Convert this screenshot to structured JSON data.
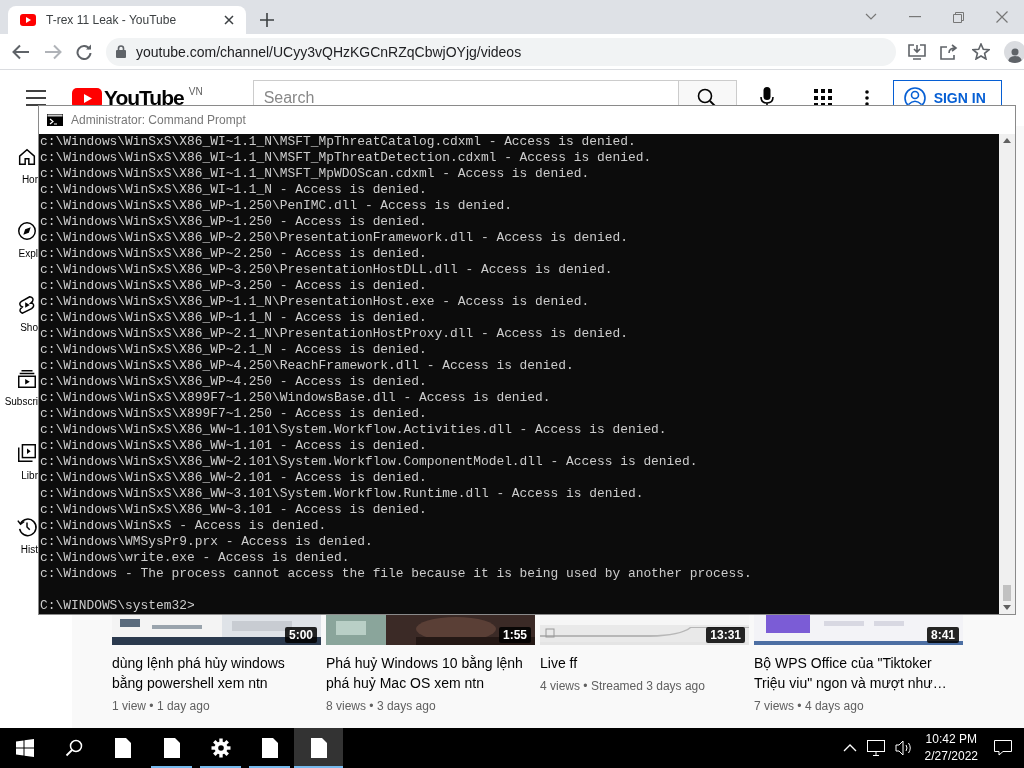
{
  "browser": {
    "tab": {
      "title": "T-rex 11 Leak - YouTube",
      "selected": true
    },
    "forward_disabled": true,
    "url": "youtube.com/channel/UCyy3vQHzKGCnRZqCbwjOYjg/videos"
  },
  "youtube": {
    "logo": "YouTube",
    "region": "VN",
    "search": {
      "placeholder": "Search"
    },
    "sign_in": "SIGN IN",
    "sidebar": [
      {
        "kind": "home",
        "label": "Hor"
      },
      {
        "kind": "explore",
        "label": "Expl"
      },
      {
        "kind": "shorts",
        "label": "Sho"
      },
      {
        "kind": "subscriptions",
        "label": "Subscri"
      },
      {
        "kind": "library",
        "label": "Libr"
      },
      {
        "kind": "history",
        "label": "Hist"
      }
    ],
    "videos": [
      {
        "duration": "5:00",
        "title": "dùng lệnh phá hủy windows bằng powershell xem ntn",
        "meta": "1 view • 1 day ago"
      },
      {
        "duration": "1:55",
        "title": "Phá huỷ Windows 10 bằng lệnh phá huỷ Mac OS xem ntn",
        "meta": "8 views • 3 days ago"
      },
      {
        "duration": "13:31",
        "title": "Live ff",
        "meta": "4 views • Streamed 3 days ago"
      },
      {
        "duration": "8:41",
        "title": "Bộ WPS Office của \"Tiktoker Triệu viu\" ngon và mượt như…",
        "meta": "7 views • 4 days ago"
      }
    ]
  },
  "console": {
    "title": "Administrator: Command Prompt",
    "lines": [
      "c:\\Windows\\WinSxS\\X86_WI~1.1_N\\MSFT_MpThreatCatalog.cdxml - Access is denied.",
      "c:\\Windows\\WinSxS\\X86_WI~1.1_N\\MSFT_MpThreatDetection.cdxml - Access is denied.",
      "c:\\Windows\\WinSxS\\X86_WI~1.1_N\\MSFT_MpWDOScan.cdxml - Access is denied.",
      "c:\\Windows\\WinSxS\\X86_WI~1.1_N - Access is denied.",
      "c:\\Windows\\WinSxS\\X86_WP~1.250\\PenIMC.dll - Access is denied.",
      "c:\\Windows\\WinSxS\\X86_WP~1.250 - Access is denied.",
      "c:\\Windows\\WinSxS\\X86_WP~2.250\\PresentationFramework.dll - Access is denied.",
      "c:\\Windows\\WinSxS\\X86_WP~2.250 - Access is denied.",
      "c:\\Windows\\WinSxS\\X86_WP~3.250\\PresentationHostDLL.dll - Access is denied.",
      "c:\\Windows\\WinSxS\\X86_WP~3.250 - Access is denied.",
      "c:\\Windows\\WinSxS\\X86_WP~1.1_N\\PresentationHost.exe - Access is denied.",
      "c:\\Windows\\WinSxS\\X86_WP~1.1_N - Access is denied.",
      "c:\\Windows\\WinSxS\\X86_WP~2.1_N\\PresentationHostProxy.dll - Access is denied.",
      "c:\\Windows\\WinSxS\\X86_WP~2.1_N - Access is denied.",
      "c:\\Windows\\WinSxS\\X86_WP~4.250\\ReachFramework.dll - Access is denied.",
      "c:\\Windows\\WinSxS\\X86_WP~4.250 - Access is denied.",
      "c:\\Windows\\WinSxS\\X899F7~1.250\\WindowsBase.dll - Access is denied.",
      "c:\\Windows\\WinSxS\\X899F7~1.250 - Access is denied.",
      "c:\\Windows\\WinSxS\\X86_WW~1.101\\System.Workflow.Activities.dll - Access is denied.",
      "c:\\Windows\\WinSxS\\X86_WW~1.101 - Access is denied.",
      "c:\\Windows\\WinSxS\\X86_WW~2.101\\System.Workflow.ComponentModel.dll - Access is denied.",
      "c:\\Windows\\WinSxS\\X86_WW~2.101 - Access is denied.",
      "c:\\Windows\\WinSxS\\X86_WW~3.101\\System.Workflow.Runtime.dll - Access is denied.",
      "c:\\Windows\\WinSxS\\X86_WW~3.101 - Access is denied.",
      "c:\\Windows\\WinSxS - Access is denied.",
      "c:\\Windows\\WMSysPr9.prx - Access is denied.",
      "c:\\Windows\\write.exe - Access is denied.",
      "c:\\Windows - The process cannot access the file because it is being used by another process."
    ],
    "prompt": "C:\\WINDOWS\\system32>"
  },
  "taskbar": {
    "items": [
      {
        "kind": "start",
        "running": false,
        "selected": false
      },
      {
        "kind": "search",
        "running": false,
        "selected": false
      },
      {
        "kind": "file",
        "running": false,
        "selected": false
      },
      {
        "kind": "file",
        "running": true,
        "selected": false
      },
      {
        "kind": "gear",
        "running": true,
        "selected": false
      },
      {
        "kind": "file",
        "running": true,
        "selected": false
      },
      {
        "kind": "file",
        "running": true,
        "selected": true
      }
    ],
    "time": "10:42 PM",
    "date": "2/27/2022"
  }
}
